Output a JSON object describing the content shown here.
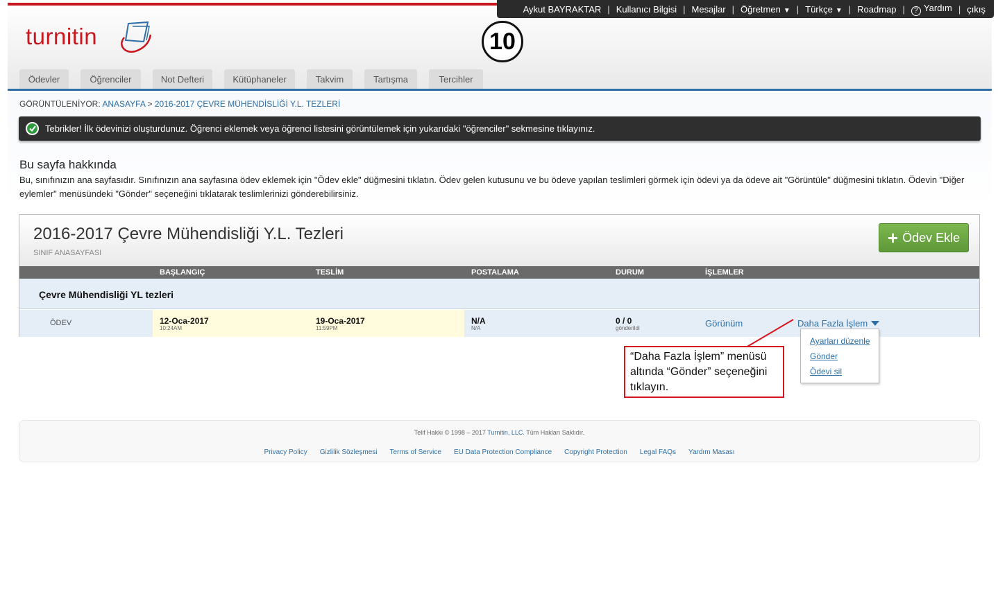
{
  "topbar": {
    "user": "Aykut BAYRAKTAR",
    "items": [
      "Kullanıcı Bilgisi",
      "Mesajlar",
      "Öğretmen",
      "Türkçe",
      "Roadmap",
      "Yardım",
      "çıkış"
    ]
  },
  "logo": {
    "text_a": "turn",
    "text_b": "itin"
  },
  "step_number": "10",
  "tabs": [
    "Ödevler",
    "Öğrenciler",
    "Not Defteri",
    "Kütüphaneler",
    "Takvim",
    "Tartışma",
    "Tercihler"
  ],
  "breadcrumb": {
    "prefix": "GÖRÜNTÜLENİYOR: ",
    "home": "ANASAYFA",
    "separator": " > ",
    "current": "2016-2017 ÇEVRE MÜHENDİSLİĞİ Y.L. TEZLERİ"
  },
  "alert": {
    "text": "Tebrikler! İlk ödevinizi oluşturdunuz. Öğrenci eklemek veya öğrenci listesini görüntülemek için yukarıdaki \"öğrenciler\" sekmesine tıklayınız."
  },
  "about": {
    "title": "Bu sayfa hakkında",
    "text": "Bu, sınıfınızın ana sayfasıdır. Sınıfınızın ana sayfasına ödev eklemek için \"Ödev ekle\" düğmesini tıklatın. Ödev gelen kutusunu ve bu ödeve yapılan teslimleri görmek için ödevi ya da ödeve ait \"Görüntüle\" düğmesini tıklatın. Ödevin \"Diğer eylemler\" menüsündeki \"Gönder\" seçeneğini tıklatarak teslimlerinizi gönderebilirsiniz."
  },
  "class": {
    "title": "2016-2017 Çevre Mühendisliği Y.L. Tezleri",
    "subtitle": "SINIF ANASAYFASI",
    "add_button": "Ödev Ekle",
    "columns": [
      "BAŞLANGIÇ",
      "TESLİM",
      "POSTALAMA",
      "DURUM",
      "İŞLEMLER"
    ],
    "folder": "Çevre Mühendisliği YL tezleri",
    "assignment": {
      "type": "ÖDEV",
      "start_date": "12-Oca-2017",
      "start_time": "10:24AM",
      "due_date": "19-Oca-2017",
      "due_time": "11:59PM",
      "post_date": "N/A",
      "post_time": "N/A",
      "status": "0 / 0",
      "status_sub": "gönderildi",
      "view": "Görünüm",
      "more": "Daha Fazla İşlem"
    }
  },
  "dropdown": [
    "Ayarları düzenle",
    "Gönder",
    "Ödevi sil"
  ],
  "callout": "“Daha Fazla İşlem” menüsü altında “Gönder” seçeneğini tıklayın.",
  "footer": {
    "copyright_pre": "Telif Hakkı © 1998 – 2017 ",
    "copyright_link": "Turnitin, LLC",
    "copyright_post": ". Tüm Hakları Saklıdır.",
    "links": [
      "Privacy Policy",
      "Gizlilik Sözleşmesi",
      "Terms of Service",
      "EU Data Protection Compliance",
      "Copyright Protection",
      "Legal FAQs",
      "Yardım Masası"
    ]
  },
  "colors": {
    "brand_red": "#c8171e",
    "link_blue": "#2d6fa6",
    "add_green": "#6da542"
  }
}
